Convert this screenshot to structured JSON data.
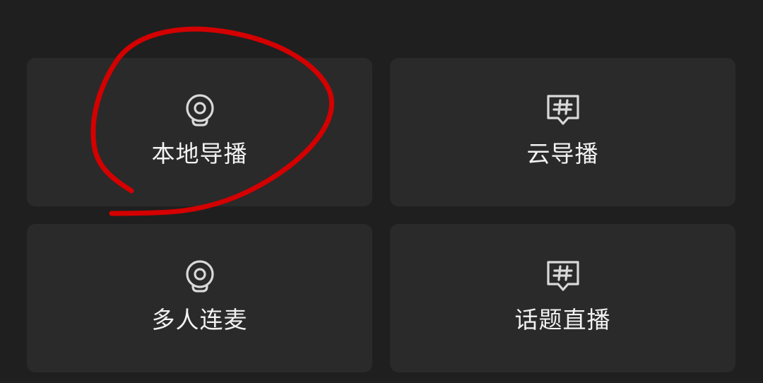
{
  "tiles": {
    "local": {
      "label": "本地导播",
      "icon": "webcam-icon"
    },
    "cloud": {
      "label": "云导播",
      "icon": "hashtag-chat-icon"
    },
    "multi": {
      "label": "多人连麦",
      "icon": "webcam-icon"
    },
    "topic": {
      "label": "话题直播",
      "icon": "hashtag-chat-icon"
    }
  },
  "colors": {
    "background": "#1f1f1f",
    "tile": "#2a2a2a",
    "text": "#f2f2f2",
    "icon": "#d9d9d9",
    "annotation": "#d40000"
  }
}
